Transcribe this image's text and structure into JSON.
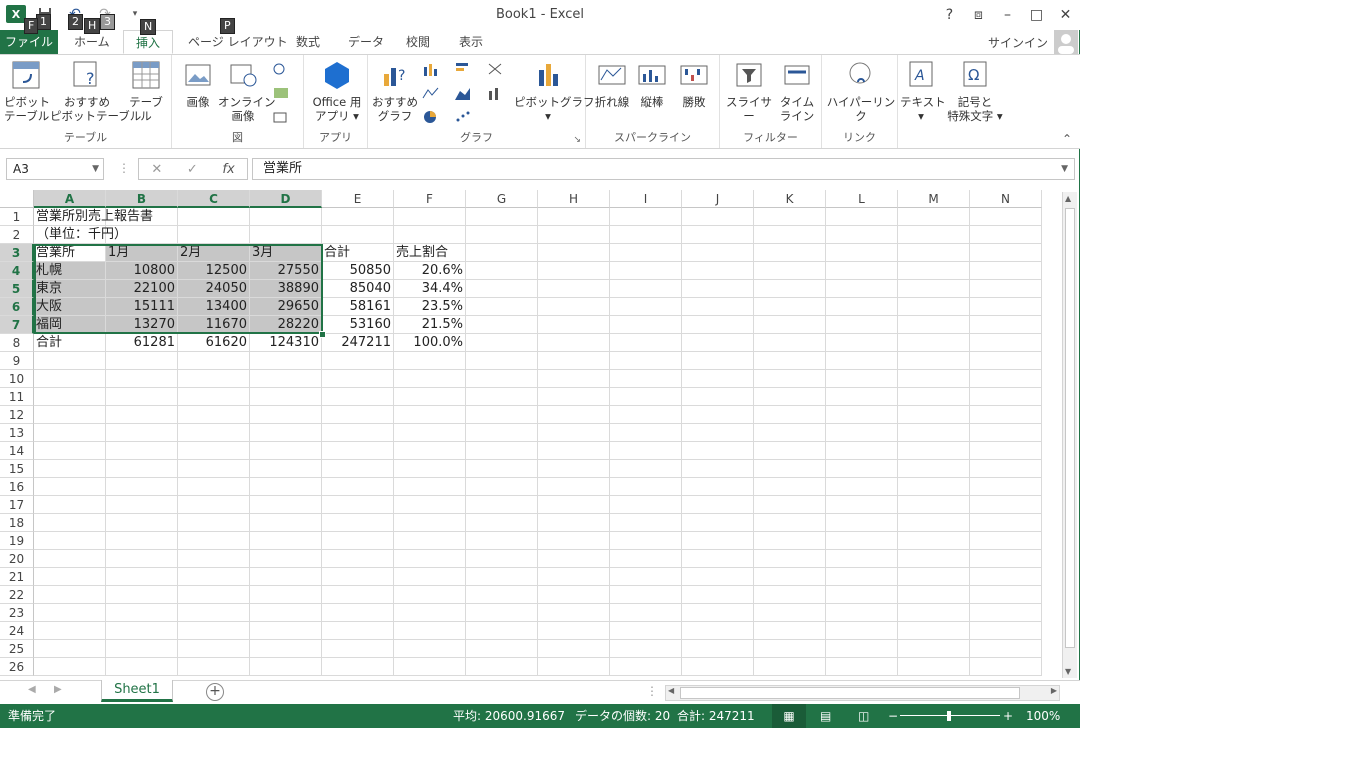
{
  "window": {
    "title": "Book1 - Excel"
  },
  "qat": {
    "keytips": [
      "1",
      "2",
      "3"
    ]
  },
  "tabs": [
    {
      "label": "ファイル",
      "keytip": "F"
    },
    {
      "label": "ホーム",
      "keytip": "H"
    },
    {
      "label": "挿入",
      "keytip": "N"
    },
    {
      "label": "ページ レイアウト",
      "keytip": "P"
    },
    {
      "label": "数式"
    },
    {
      "label": "データ"
    },
    {
      "label": "校閲"
    },
    {
      "label": "表示"
    }
  ],
  "account": {
    "signin": "サインイン"
  },
  "ribbon": {
    "groups": {
      "table": "テーブル",
      "illustrations": "図",
      "apps": "アプリ",
      "charts": "グラフ",
      "sparklines": "スパークライン",
      "filters": "フィルター",
      "links": "リンク"
    },
    "buttons": {
      "pivot_table": "ピボット\nテーブル",
      "recommended_pivot": "おすすめ\nピボットテーブル",
      "table": "テーブル",
      "pictures": "画像",
      "online_pictures": "オンライン\n画像",
      "office_apps": "Office 用\nアプリ ▾",
      "recommended_charts": "おすすめ\nグラフ",
      "pivot_chart": "ピボットグラフ\n▾",
      "line": "折れ線",
      "column": "縦棒",
      "win_loss": "勝敗",
      "slicer": "スライサー",
      "timeline": "タイム\nライン",
      "hyperlink": "ハイパーリンク",
      "text": "テキスト\n▾",
      "symbols": "記号と\n特殊文字 ▾"
    }
  },
  "formula_bar": {
    "name_box": "A3",
    "content": "営業所",
    "fx": "fx"
  },
  "columns": [
    "A",
    "B",
    "C",
    "D",
    "E",
    "F",
    "G",
    "H",
    "I",
    "J",
    "K",
    "L",
    "M",
    "N"
  ],
  "rows": [
    "1",
    "2",
    "3",
    "4",
    "5",
    "6",
    "7",
    "8",
    "9",
    "10",
    "11",
    "12",
    "13",
    "14",
    "15",
    "16",
    "17",
    "18",
    "19",
    "20",
    "21",
    "22",
    "23",
    "24",
    "25",
    "26"
  ],
  "cells": {
    "A1": "営業所別売上報告書",
    "A2": "（単位：千円）",
    "A3": "営業所",
    "B3": "1月",
    "C3": "2月",
    "D3": "3月",
    "E3": "合計",
    "F3": "売上割合",
    "A4": "札幌",
    "B4": "10800",
    "C4": "12500",
    "D4": "27550",
    "E4": "50850",
    "F4": "20.6%",
    "A5": "東京",
    "B5": "22100",
    "C5": "24050",
    "D5": "38890",
    "E5": "85040",
    "F5": "34.4%",
    "A6": "大阪",
    "B6": "15111",
    "C6": "13400",
    "D6": "29650",
    "E6": "58161",
    "F6": "23.5%",
    "A7": "福岡",
    "B7": "13270",
    "C7": "11670",
    "D7": "28220",
    "E7": "53160",
    "F7": "21.5%",
    "A8": "合計",
    "B8": "61281",
    "C8": "61620",
    "D8": "124310",
    "E8": "247211",
    "F8": "100.0%"
  },
  "sheet": {
    "tab": "Sheet1"
  },
  "status": {
    "ready": "準備完了",
    "average": "平均: 20600.91667",
    "count": "データの個数: 20",
    "sum": "合計: 247211",
    "zoom": "100%"
  },
  "colors": {
    "accent": "#217346",
    "selection": "#c6c6c6"
  }
}
